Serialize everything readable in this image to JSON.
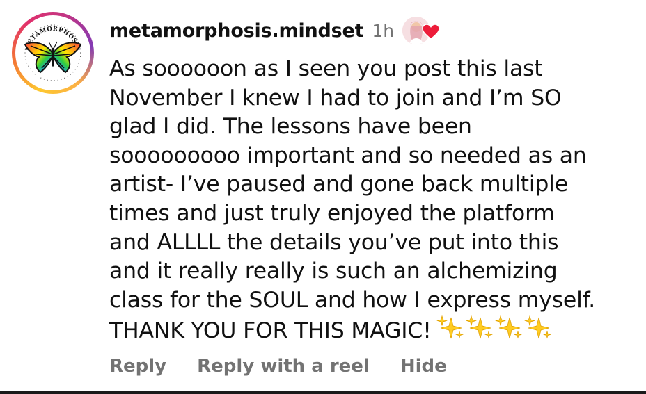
{
  "comment": {
    "username": "metamorphosis.mindset",
    "time": "1h",
    "avatar_text": "METAMORPHOSIS",
    "liked_by_author": true,
    "lines": [
      "As soooooon as I seen you post this last",
      "November I knew I had to join and I’m SO",
      "glad I did. The lessons have been",
      "sooooooooo important and so needed as an",
      "artist- I’ve paused and gone back multiple",
      "times and just truly enjoyed the platform",
      "and ALLLL the details you’ve put into this",
      "and it really really is such an alchemizing",
      "class for the SOUL and how I express myself.",
      "THANK YOU FOR THIS MAGIC!"
    ],
    "emoji": "sparkles-emoji x4"
  },
  "actions": {
    "reply": "Reply",
    "reply_with_reel": "Reply with a reel",
    "hide": "Hide"
  },
  "colors": {
    "text": "#111111",
    "muted": "#737373",
    "heart": "#ed1c3a",
    "ring_start": "#fdc830",
    "ring_end": "#c13584"
  }
}
